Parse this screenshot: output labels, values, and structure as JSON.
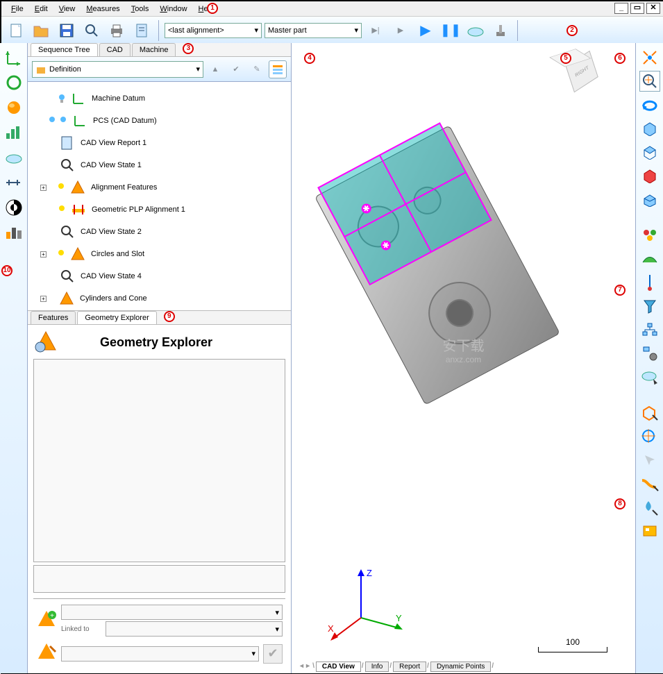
{
  "menu": {
    "file": "File",
    "edit": "Edit",
    "view": "View",
    "measures": "Measures",
    "tools": "Tools",
    "window": "Window",
    "help": "Help"
  },
  "toolbar": {
    "alignment_dd": "<last alignment>",
    "part_dd": "Master part"
  },
  "left_tabs": {
    "seq": "Sequence Tree",
    "cad": "CAD",
    "machine": "Machine"
  },
  "seq": {
    "dd": "Definition"
  },
  "tree": {
    "items": [
      {
        "label": "Machine Datum"
      },
      {
        "label": "PCS (CAD Datum)"
      },
      {
        "label": "CAD View Report 1"
      },
      {
        "label": "CAD View State 1"
      },
      {
        "label": "Alignment Features"
      },
      {
        "label": "Geometric PLP Alignment 1"
      },
      {
        "label": "CAD View State 2"
      },
      {
        "label": "Circles and Slot"
      },
      {
        "label": "CAD View State 4"
      },
      {
        "label": "Cylinders and Cone"
      }
    ]
  },
  "sub_tabs": {
    "features": "Features",
    "ge": "Geometry Explorer"
  },
  "ge": {
    "title": "Geometry Explorer",
    "linked": "Linked to"
  },
  "view_tabs": {
    "cad": "CAD View",
    "info": "Info",
    "report": "Report",
    "dyn": "Dynamic Points"
  },
  "scale": {
    "value": "100"
  },
  "axes": {
    "x": "X",
    "y": "Y",
    "z": "Z"
  },
  "navcube": {
    "right": "RIGHT"
  },
  "annotations": {
    "a1": "1",
    "a2": "2",
    "a3": "3",
    "a4": "4",
    "a5": "5",
    "a6": "6",
    "a7": "7",
    "a8": "8",
    "a9": "9",
    "a10": "10"
  },
  "watermark": {
    "big": "安下载",
    "small": "anxz.com"
  }
}
